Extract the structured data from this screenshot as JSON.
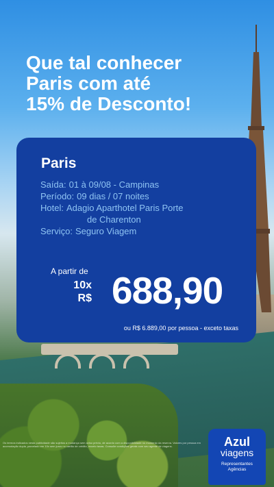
{
  "headline": {
    "lines": [
      "Que tal conhecer",
      "Paris com até",
      "15% de Desconto!"
    ]
  },
  "offer": {
    "city": "Paris",
    "departure_label": "Saída:",
    "departure_value": "01 à 09/08 - Campinas",
    "period_label": "Período:",
    "period_value": "09 dias / 07 noites",
    "hotel_label": "Hotel:",
    "hotel_value_line1": "Adagio Aparthotel Paris Porte",
    "hotel_value_line2": "de Charenton",
    "service_label": "Serviço:",
    "service_value": "Seguro Viagem",
    "from_label": "A partir de",
    "installments": "10x",
    "currency": "R$",
    "price": "688,90",
    "footnote": "ou R$ 6.889,00 por pessoa - exceto taxas"
  },
  "legal_text": "Os termos indicados nesta publicidade são sujeitos a mudança sem aviso prévio, de acordo com a disponibilidade no momento da reserva. Valores por pessoa em acomodação dupla, parcelado em 10x sem juros no cartão de crédito, exceto taxas. Consulte condições gerais com seu agente de viagens.",
  "brand": {
    "name": "Azul",
    "subname": "viagens",
    "tagline_line1": "Representantes",
    "tagline_line2": "Agências"
  },
  "colors": {
    "card": "#133fa0",
    "detail_text": "#8fc4f3",
    "brand": "#1346b4"
  }
}
